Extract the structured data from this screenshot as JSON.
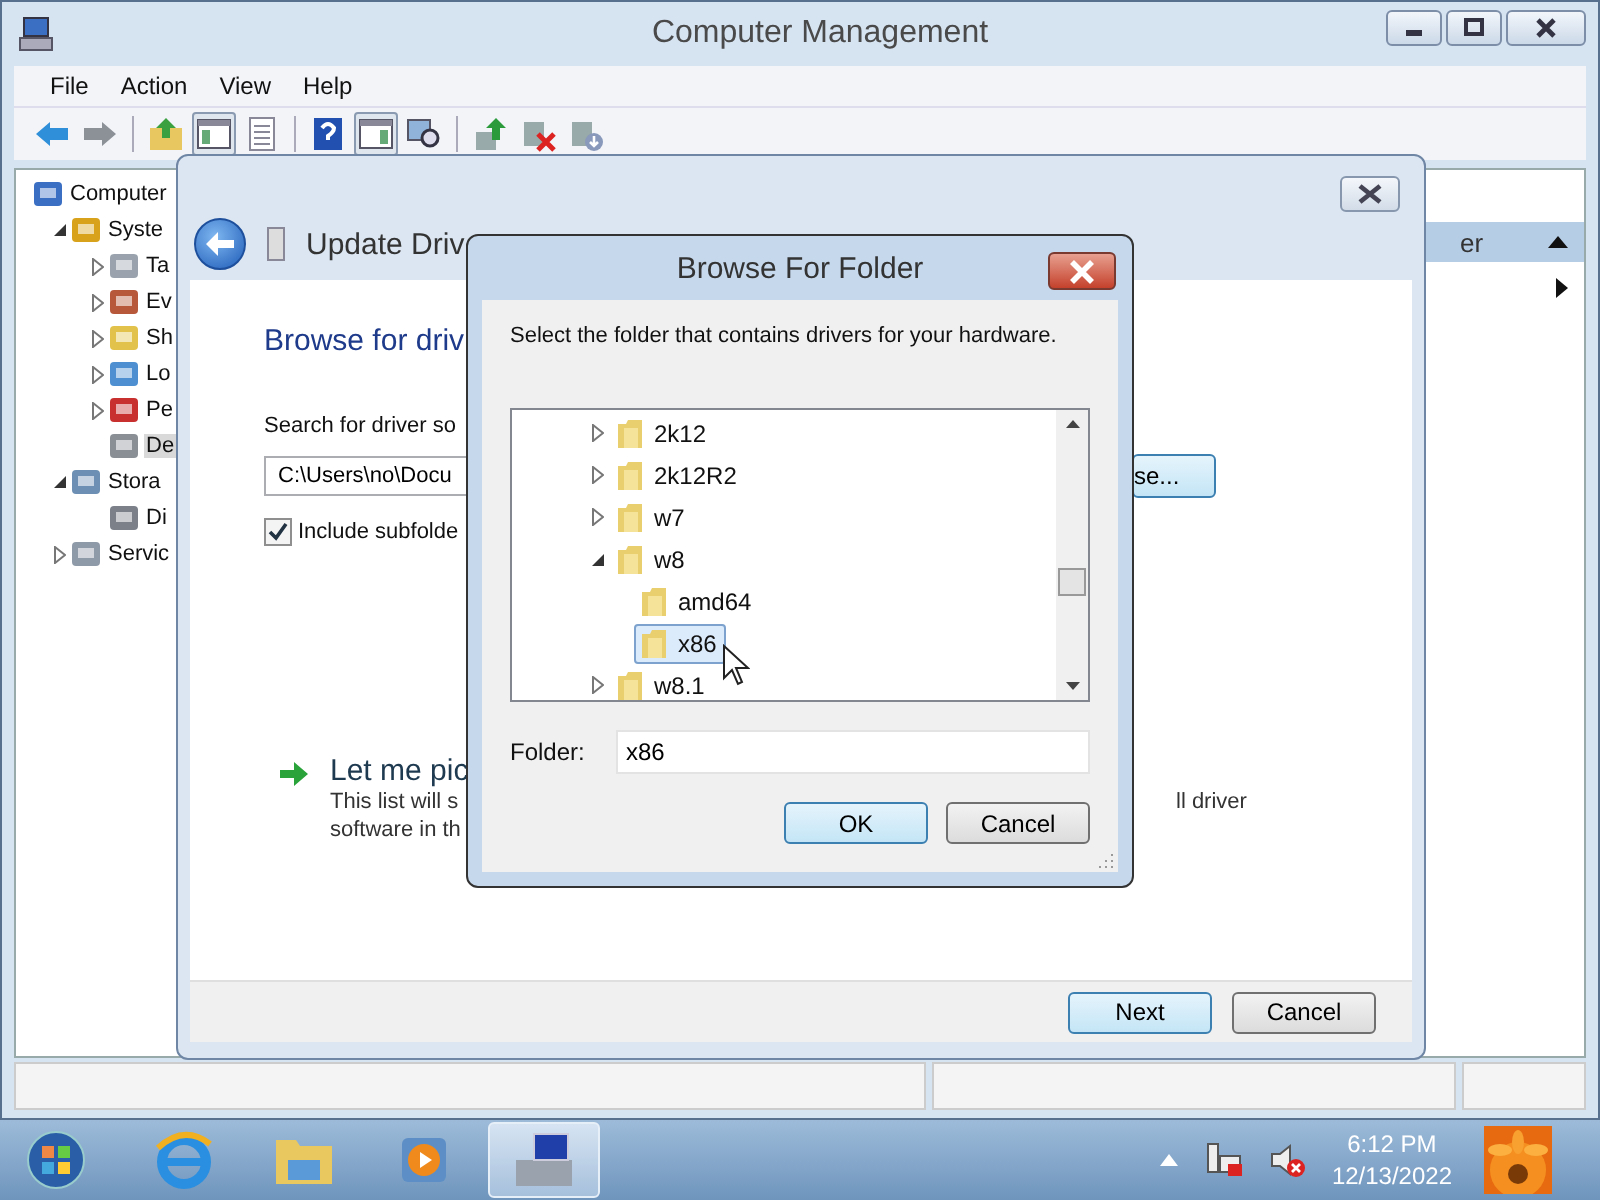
{
  "main_window": {
    "title": "Computer Management",
    "menu": [
      "File",
      "Action",
      "View",
      "Help"
    ],
    "toolbar_groups": [
      [
        {
          "kind": "back",
          "pressed": false
        },
        {
          "kind": "forward",
          "pressed": false
        }
      ],
      [
        {
          "kind": "up",
          "pressed": false
        },
        {
          "kind": "tree",
          "pressed": true
        },
        {
          "kind": "export",
          "pressed": false
        }
      ],
      [
        {
          "kind": "help",
          "pressed": false
        },
        {
          "kind": "actions",
          "pressed": true
        },
        {
          "kind": "scan",
          "pressed": false
        }
      ],
      [
        {
          "kind": "update",
          "pressed": false
        },
        {
          "kind": "uninstall",
          "pressed": false
        },
        {
          "kind": "disable",
          "pressed": false
        }
      ]
    ],
    "tree": [
      {
        "label": "Computer",
        "kind": "computer",
        "expandable": false,
        "selected": false,
        "children": [
          {
            "label": "Syste",
            "kind": "tools",
            "expandable": true,
            "expanded": true,
            "selected": false,
            "children": [
              {
                "label": "Ta",
                "kind": "clock",
                "expandable": true,
                "expanded": false,
                "selected": false
              },
              {
                "label": "Ev",
                "kind": "log",
                "expandable": true,
                "expanded": false,
                "selected": false
              },
              {
                "label": "Sh",
                "kind": "share",
                "expandable": true,
                "expanded": false,
                "selected": false
              },
              {
                "label": "Lo",
                "kind": "users",
                "expandable": true,
                "expanded": false,
                "selected": false
              },
              {
                "label": "Pe",
                "kind": "gauge",
                "expandable": true,
                "expanded": false,
                "selected": false
              },
              {
                "label": "De",
                "kind": "devices",
                "expandable": false,
                "selected": true
              }
            ]
          },
          {
            "label": "Stora",
            "kind": "storage",
            "expandable": true,
            "expanded": true,
            "selected": false,
            "children": [
              {
                "label": "Di",
                "kind": "disk",
                "expandable": false,
                "selected": false
              }
            ]
          },
          {
            "label": "Servic",
            "kind": "services",
            "expandable": true,
            "expanded": false,
            "selected": false
          }
        ]
      }
    ],
    "actions_header": "er"
  },
  "update_dialog": {
    "title": "Update Driv",
    "heading": "Browse for driv",
    "search_label": "Search for driver so",
    "path": "C:\\Users\\no\\Docu",
    "include_subfolders": {
      "label": "Include subfolde",
      "checked": true
    },
    "browse_button": "se...",
    "pick_title": "Let me pic",
    "pick_lines": [
      "This list will s",
      "software in th"
    ],
    "pick_tail": "ll driver",
    "buttons": [
      "Next",
      "Cancel"
    ]
  },
  "browse_dialog": {
    "title": "Browse For Folder",
    "instruction": "Select the folder that contains drivers for your hardware.",
    "tree": [
      {
        "label": "2k12",
        "expandable": true,
        "expanded": false,
        "selected": false
      },
      {
        "label": "2k12R2",
        "expandable": true,
        "expanded": false,
        "selected": false
      },
      {
        "label": "w7",
        "expandable": true,
        "expanded": false,
        "selected": false
      },
      {
        "label": "w8",
        "expandable": true,
        "expanded": true,
        "selected": false,
        "children": [
          {
            "label": "amd64",
            "expandable": false,
            "selected": false
          },
          {
            "label": "x86",
            "expandable": false,
            "selected": true
          }
        ]
      },
      {
        "label": "w8.1",
        "expandable": true,
        "expanded": false,
        "selected": false
      }
    ],
    "folder_label": "Folder:",
    "folder_value": "x86",
    "buttons": [
      "OK",
      "Cancel"
    ]
  },
  "taskbar": {
    "apps": [
      {
        "kind": "browser",
        "active": false
      },
      {
        "kind": "folder",
        "active": false
      },
      {
        "kind": "media",
        "active": false
      },
      {
        "kind": "management",
        "active": true
      }
    ],
    "tray": [
      {
        "kind": "show"
      },
      {
        "kind": "network"
      },
      {
        "kind": "volume"
      }
    ],
    "time": "6:12 PM",
    "date": "12/13/2022"
  }
}
